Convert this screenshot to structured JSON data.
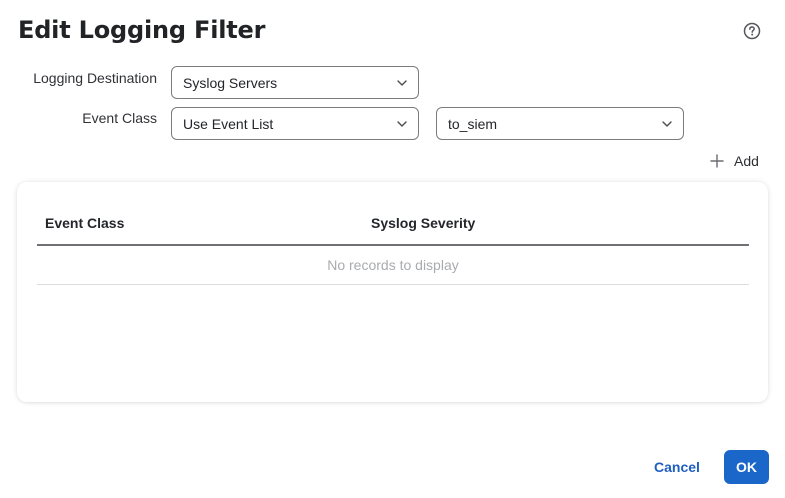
{
  "dialog": {
    "title": "Edit Logging Filter",
    "help_icon": "help-circle-icon"
  },
  "form": {
    "logging_destination": {
      "label": "Logging Destination",
      "value": "Syslog Servers"
    },
    "event_class": {
      "label": "Event Class",
      "value": "Use Event List"
    },
    "event_list": {
      "value": "to_siem"
    }
  },
  "add_button": {
    "label": "Add",
    "icon": "plus-icon"
  },
  "table": {
    "columns": [
      "Event Class",
      "Syslog Severity"
    ],
    "empty_message": "No records to display",
    "rows": []
  },
  "footer": {
    "cancel_label": "Cancel",
    "ok_label": "OK"
  },
  "colors": {
    "primary": "#1b67c9",
    "link": "#1f5fbf",
    "border": "#7a7c80",
    "muted_text": "#a9abaf"
  }
}
